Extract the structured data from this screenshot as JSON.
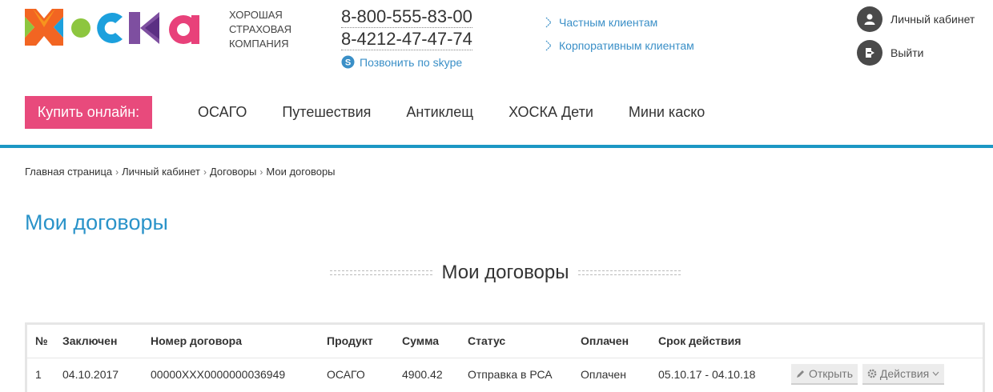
{
  "brand": {
    "logo_text": "ХОСКА",
    "tagline": [
      "ХОРОШАЯ",
      "СТРАХОВАЯ",
      "КОМПАНИЯ"
    ]
  },
  "contacts": {
    "phones": [
      "8-800-555-83-00",
      "8-4212-47-47-74"
    ],
    "skype_label": "Позвонить по skype"
  },
  "client_links": [
    "Частным клиентам",
    "Корпоративным клиентам"
  ],
  "user_menu": {
    "account_label": "Личный кабинет",
    "logout_label": "Выйти"
  },
  "nav": {
    "buy_label": "Купить онлайн:",
    "items": [
      "ОСАГО",
      "Путешествия",
      "Антиклещ",
      "ХОСКА Дети",
      "Мини каско"
    ]
  },
  "breadcrumb": [
    "Главная страница",
    "Личный кабинет",
    "Договоры",
    "Мои договоры"
  ],
  "page_title": "Мои договоры",
  "section_title": "Мои договоры",
  "table": {
    "headers": [
      "№",
      "Заключен",
      "Номер договора",
      "Продукт",
      "Сумма",
      "Статус",
      "Оплачен",
      "Срок действия",
      ""
    ],
    "rows": [
      {
        "num": "1",
        "date": "04.10.2017",
        "contract": "00000XXX0000000036949",
        "product": "ОСАГО",
        "sum": "4900.42",
        "status": "Отправка в РСА",
        "paid": "Оплачен",
        "period": "05.10.17 - 04.10.18",
        "open_label": "Открыть",
        "actions_label": "Действия"
      }
    ]
  },
  "colors": {
    "accent_blue": "#1c97c4",
    "link_blue": "#3a8fc7",
    "buy_pink": "#e84a7c",
    "logo_orange": "#f26522",
    "logo_green": "#8dc63f",
    "logo_blue": "#1ca0dd",
    "logo_purple": "#7e4fa0",
    "logo_pink": "#e8417a"
  }
}
